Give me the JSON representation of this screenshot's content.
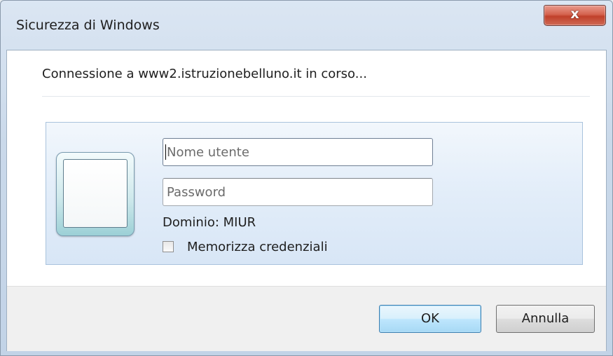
{
  "window": {
    "title": "Sicurezza di Windows",
    "close_glyph": "x"
  },
  "message": "Connessione a www2.istruzionebelluno.it in corso...",
  "credentials": {
    "username_placeholder": "Nome utente",
    "password_placeholder": "Password",
    "domain_text": "Dominio: MIUR",
    "remember_label": "Memorizza credenziali",
    "remember_checked": false
  },
  "buttons": {
    "ok_label": "OK",
    "cancel_label": "Annulla"
  },
  "colors": {
    "close_button": "#c0402a",
    "ok_button_border": "#3c7fb1",
    "panel_border": "#a9c3dd"
  },
  "icons": {
    "user_tile": "user-tile-icon",
    "close": "close-icon"
  }
}
